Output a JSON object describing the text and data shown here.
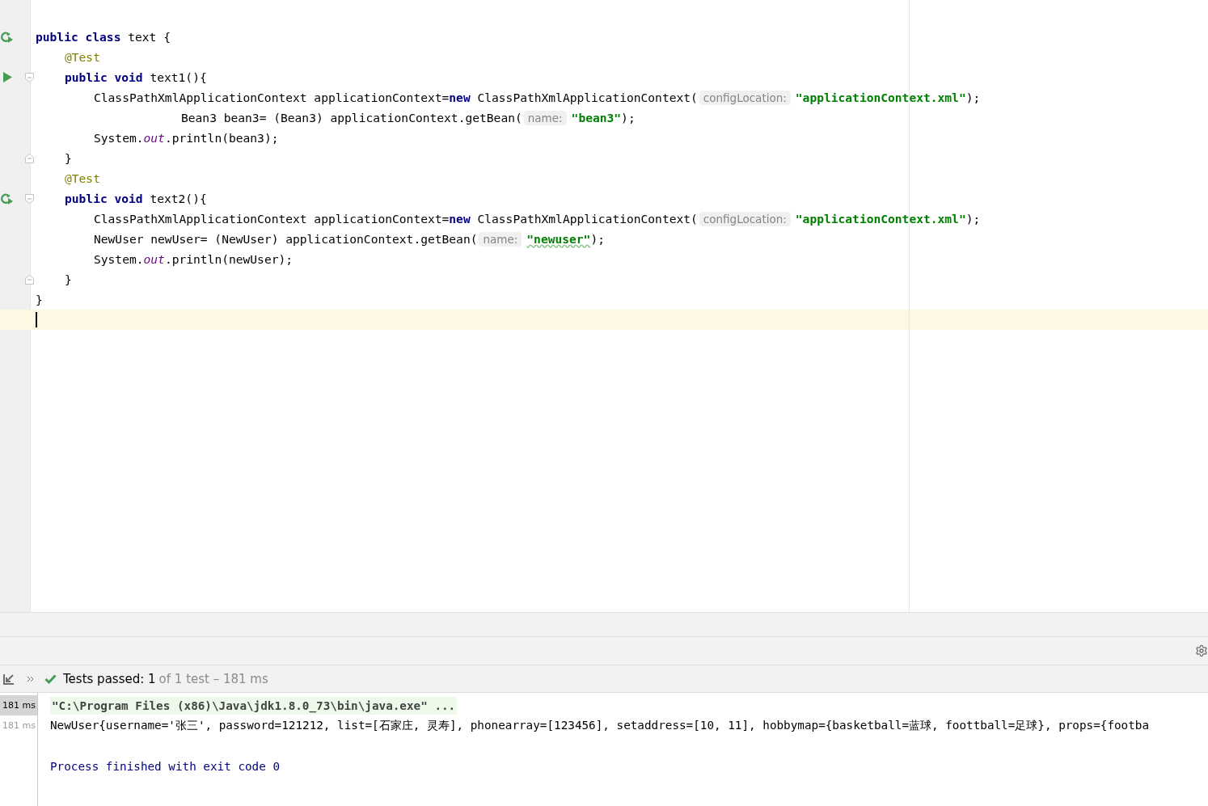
{
  "editor": {
    "lines": [
      {
        "gutter": {
          "kind": "rerun"
        },
        "tokens": [
          {
            "kind": "kw",
            "text": "public class"
          },
          {
            "kind": "plain",
            "text": " text {"
          }
        ],
        "children": [
          {
            "tokens": [
              {
                "kind": "ann",
                "text": "@Test"
              }
            ]
          },
          {
            "gutter": {
              "kind": "run"
            },
            "fold": {
              "kind": "start"
            },
            "tokens": [
              {
                "kind": "kw",
                "text": "public void"
              },
              {
                "kind": "plain",
                "text": " text1(){"
              }
            ],
            "children": [
              {
                "tokens": [
                  {
                    "kind": "plain",
                    "text": "ClassPathXmlApplicationContext applicationContext="
                  },
                  {
                    "kind": "kw",
                    "text": "new"
                  },
                  {
                    "kind": "plain",
                    "text": " ClassPathXmlApplicationContext("
                  },
                  {
                    "kind": "hint",
                    "text": "configLocation:"
                  },
                  {
                    "kind": "str",
                    "text": "\"applicationContext.xml\""
                  },
                  {
                    "kind": "plain",
                    "text": ");"
                  }
                ],
                "children": [
                  {
                    "continuation": true,
                    "tokens": [
                      {
                        "kind": "plain",
                        "text": "Bean3 bean3= (Bean3) applicationContext.getBean("
                      },
                      {
                        "kind": "hint",
                        "text": "name:"
                      },
                      {
                        "kind": "str",
                        "text": "\"bean3\""
                      },
                      {
                        "kind": "plain",
                        "text": ");"
                      }
                    ]
                  }
                ]
              },
              {
                "tokens": [
                  {
                    "kind": "plain",
                    "text": "System."
                  },
                  {
                    "kind": "field",
                    "text": "out"
                  },
                  {
                    "kind": "plain",
                    "text": ".println(bean3);"
                  }
                ]
              }
            ]
          },
          {
            "fold": {
              "kind": "end"
            },
            "tokens": [
              {
                "kind": "plain",
                "text": "}"
              }
            ]
          },
          {
            "tokens": [
              {
                "kind": "ann",
                "text": "@Test"
              }
            ]
          },
          {
            "gutter": {
              "kind": "rerun"
            },
            "fold": {
              "kind": "start"
            },
            "tokens": [
              {
                "kind": "kw",
                "text": "public void"
              },
              {
                "kind": "plain",
                "text": " text2(){"
              }
            ],
            "children": [
              {
                "tokens": [
                  {
                    "kind": "plain",
                    "text": "ClassPathXmlApplicationContext applicationContext="
                  },
                  {
                    "kind": "kw",
                    "text": "new"
                  },
                  {
                    "kind": "plain",
                    "text": " ClassPathXmlApplicationContext("
                  },
                  {
                    "kind": "hint",
                    "text": "configLocation:"
                  },
                  {
                    "kind": "str",
                    "text": "\"applicationContext.xml\""
                  },
                  {
                    "kind": "plain",
                    "text": ");"
                  }
                ]
              },
              {
                "tokens": [
                  {
                    "kind": "plain",
                    "text": "NewUser newUser= (NewUser) applicationContext.getBean("
                  },
                  {
                    "kind": "hint",
                    "text": "name:"
                  },
                  {
                    "kind": "typo",
                    "text": "\"newuser\""
                  },
                  {
                    "kind": "plain",
                    "text": ");"
                  }
                ]
              },
              {
                "tokens": [
                  {
                    "kind": "plain",
                    "text": "System."
                  },
                  {
                    "kind": "field",
                    "text": "out"
                  },
                  {
                    "kind": "plain",
                    "text": ".println(newUser);"
                  }
                ]
              }
            ]
          },
          {
            "fold": {
              "kind": "end"
            },
            "tokens": [
              {
                "kind": "plain",
                "text": "}"
              }
            ]
          }
        ]
      },
      {
        "tokens": [
          {
            "kind": "plain",
            "text": "}"
          }
        ]
      },
      {
        "current": true
      }
    ]
  },
  "run_panel": {
    "status": {
      "passed": "Tests passed: 1",
      "detail": "of 1 test – 181 ms"
    },
    "tree": [
      {
        "label": "181 ms",
        "selected": true
      },
      {
        "label": "181 ms",
        "selected": false
      }
    ],
    "console": [
      {
        "kind": "command",
        "text": "\"C:\\Program Files (x86)\\Java\\jdk1.8.0_73\\bin\\java.exe\" ..."
      },
      {
        "kind": "output",
        "text": "NewUser{username='张三', password=121212, list=[石家庄, 灵寿], phonearray=[123456], setaddress=[10, 11], hobbymap={basketball=蓝球, foottball=足球}, props={footba"
      },
      {
        "kind": "blank"
      },
      {
        "kind": "exit",
        "text": "Process finished with exit code 0"
      }
    ]
  }
}
